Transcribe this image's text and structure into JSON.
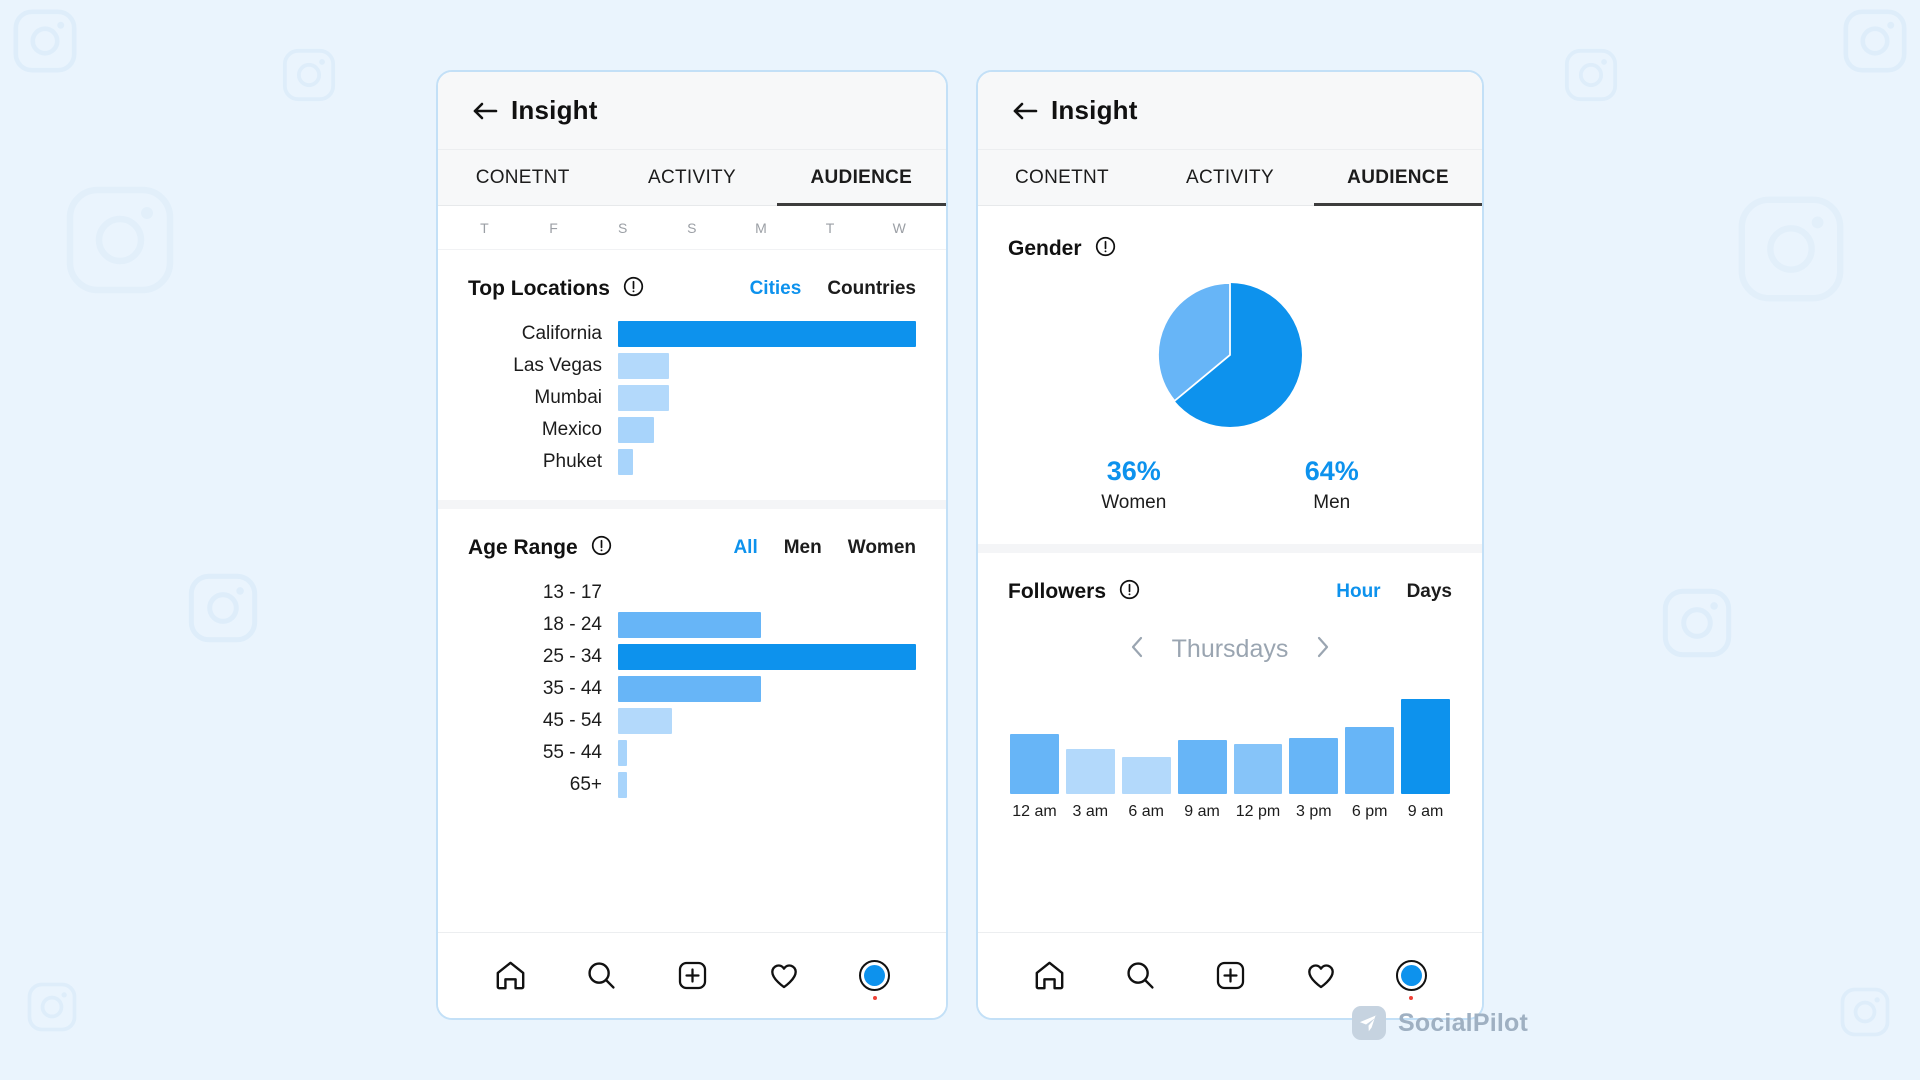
{
  "brand": {
    "accent_blue": "#0d92ed",
    "mid_blue": "#67b5f7",
    "light_blue": "#b3d9fb",
    "logo_text": "SocialPilot",
    "logo_mark_icon": "paper-plane-icon"
  },
  "left_panel": {
    "header": {
      "title": "Insight",
      "back_icon": "back-arrow-icon"
    },
    "tabs": [
      {
        "label": "CONETNT",
        "active": false
      },
      {
        "label": "ACTIVITY",
        "active": false
      },
      {
        "label": "AUDIENCE",
        "active": true
      }
    ],
    "weekdays": [
      "T",
      "F",
      "S",
      "S",
      "M",
      "T",
      "W"
    ],
    "top_locations": {
      "title": "Top Locations",
      "info_icon": "info-circle-icon",
      "toggle": [
        {
          "label": "Cities",
          "active": true
        },
        {
          "label": "Countries",
          "active": false
        }
      ]
    },
    "age_range": {
      "title": "Age Range",
      "info_icon": "info-circle-icon",
      "toggle": [
        {
          "label": "All",
          "active": true
        },
        {
          "label": "Men",
          "active": false
        },
        {
          "label": "Women",
          "active": false
        }
      ]
    },
    "bottom_nav": [
      {
        "icon": "home-icon"
      },
      {
        "icon": "search-icon"
      },
      {
        "icon": "add-post-icon"
      },
      {
        "icon": "heart-icon"
      },
      {
        "icon": "profile-avatar-icon"
      }
    ]
  },
  "right_panel": {
    "header": {
      "title": "Insight",
      "back_icon": "back-arrow-icon"
    },
    "tabs": [
      {
        "label": "CONETNT",
        "active": false
      },
      {
        "label": "ACTIVITY",
        "active": false
      },
      {
        "label": "AUDIENCE",
        "active": true
      }
    ],
    "gender": {
      "title": "Gender",
      "info_icon": "info-circle-icon",
      "stats": [
        {
          "pct": "36%",
          "label": "Women"
        },
        {
          "pct": "64%",
          "label": "Men"
        }
      ]
    },
    "followers": {
      "title": "Followers",
      "info_icon": "info-circle-icon",
      "toggle": [
        {
          "label": "Hour",
          "active": true
        },
        {
          "label": "Days",
          "active": false
        }
      ],
      "day_nav": {
        "prev_icon": "chevron-left-icon",
        "next_icon": "chevron-right-icon",
        "current_day": "Thursdays"
      }
    },
    "bottom_nav": [
      {
        "icon": "home-icon"
      },
      {
        "icon": "search-icon"
      },
      {
        "icon": "add-post-icon"
      },
      {
        "icon": "heart-icon"
      },
      {
        "icon": "profile-avatar-icon"
      }
    ]
  },
  "chart_data": [
    {
      "type": "bar",
      "orientation": "horizontal",
      "title": "Top Locations",
      "xlabel": "",
      "ylabel": "",
      "categories": [
        "California",
        "Las Vegas",
        "Mumbai",
        "Mexico",
        "Phuket"
      ],
      "values": [
        100,
        17,
        17,
        12,
        5
      ],
      "unit": "percent_of_max",
      "xlim": [
        0,
        100
      ],
      "grid": false,
      "legend": "none",
      "colors": [
        "#0d92ed",
        "#b3d9fb",
        "#b3d9fb",
        "#a8d4fb",
        "#a8d4fb"
      ]
    },
    {
      "type": "bar",
      "orientation": "horizontal",
      "title": "Age Range",
      "xlabel": "",
      "ylabel": "",
      "categories": [
        "13 - 17",
        "18 - 24",
        "25 - 34",
        "35 - 44",
        "45 - 54",
        "55 - 44",
        "65+"
      ],
      "values": [
        0,
        48,
        100,
        48,
        18,
        3,
        3
      ],
      "unit": "percent_of_max",
      "xlim": [
        0,
        100
      ],
      "grid": false,
      "legend": "none",
      "colors": [
        "#b3d9fb",
        "#67b5f7",
        "#0d92ed",
        "#67b5f7",
        "#b3d9fb",
        "#a8d4fb",
        "#a8d4fb"
      ]
    },
    {
      "type": "pie",
      "title": "Gender",
      "labels": [
        "Men",
        "Women"
      ],
      "values": [
        64,
        36
      ],
      "unit": "percent",
      "colors": [
        "#0d92ed",
        "#67b5f7"
      ],
      "legend": "below"
    },
    {
      "type": "bar",
      "orientation": "vertical",
      "title": "Followers",
      "subtitle": "Thursdays",
      "xlabel": "",
      "ylabel": "",
      "categories": [
        "12 am",
        "3 am",
        "6 am",
        "9 am",
        "12 pm",
        "3 pm",
        "6 pm",
        "9 am"
      ],
      "values": [
        56,
        42,
        34,
        50,
        46,
        52,
        62,
        88
      ],
      "unit": "percent_of_max",
      "ylim": [
        0,
        100
      ],
      "grid": false,
      "legend": "none",
      "colors": [
        "#67b5f7",
        "#b3d9fb",
        "#b3d9fb",
        "#67b5f7",
        "#86c4f9",
        "#67b5f7",
        "#67b5f7",
        "#0d92ed"
      ]
    }
  ]
}
